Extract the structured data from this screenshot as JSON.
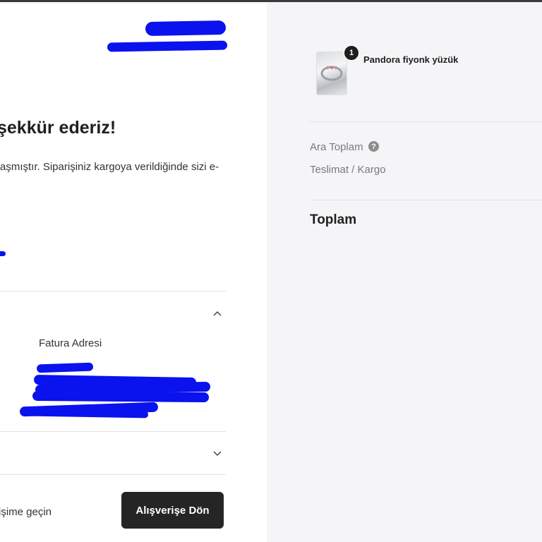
{
  "thanks": {
    "title": "şekkür ederiz!",
    "message": "aşmıştır. Siparişiniz kargoya verildiğinde sizi e-"
  },
  "address": {
    "billing_label": "Fatura Adresi"
  },
  "footer": {
    "link_text": "işime geçin",
    "back_button": "Alışverişe Dön"
  },
  "cart": {
    "item": {
      "name": "Pandora fiyonk yüzük",
      "quantity": "1"
    }
  },
  "summary": {
    "subtotal_label": "Ara Toplam",
    "shipping_label": "Teslimat / Kargo",
    "total_label": "Toplam",
    "help_glyph": "?"
  },
  "colors": {
    "button_bg": "#252525",
    "sidebar_bg": "#f5f5f7",
    "redaction": "#0a12ee"
  }
}
